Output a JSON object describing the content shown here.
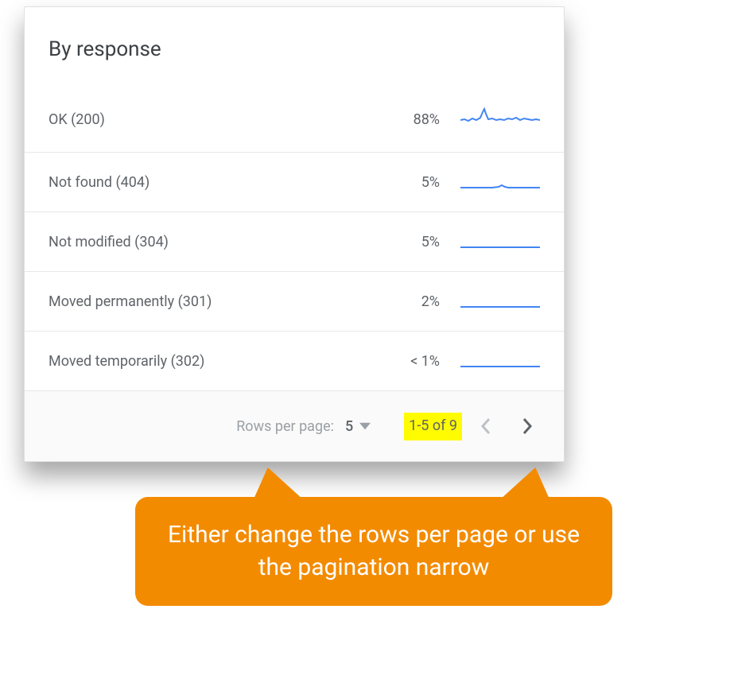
{
  "card": {
    "title": "By response",
    "rows": [
      {
        "label": "OK (200)",
        "value": "88%",
        "spark": "high"
      },
      {
        "label": "Not found (404)",
        "value": "5%",
        "spark": "low"
      },
      {
        "label": "Not modified (304)",
        "value": "5%",
        "spark": "low"
      },
      {
        "label": "Moved permanently (301)",
        "value": "2%",
        "spark": "flat"
      },
      {
        "label": "Moved temporarily (302)",
        "value": "< 1%",
        "spark": "flat"
      }
    ]
  },
  "pagination": {
    "rows_label": "Rows per page:",
    "rows_value": "5",
    "range": "1-5 of 9"
  },
  "callout": {
    "text": "Either change the rows per page or use the pagination narrow"
  },
  "colors": {
    "spark": "#4285f4",
    "highlight": "#fffb00",
    "callout": "#f38b00"
  }
}
